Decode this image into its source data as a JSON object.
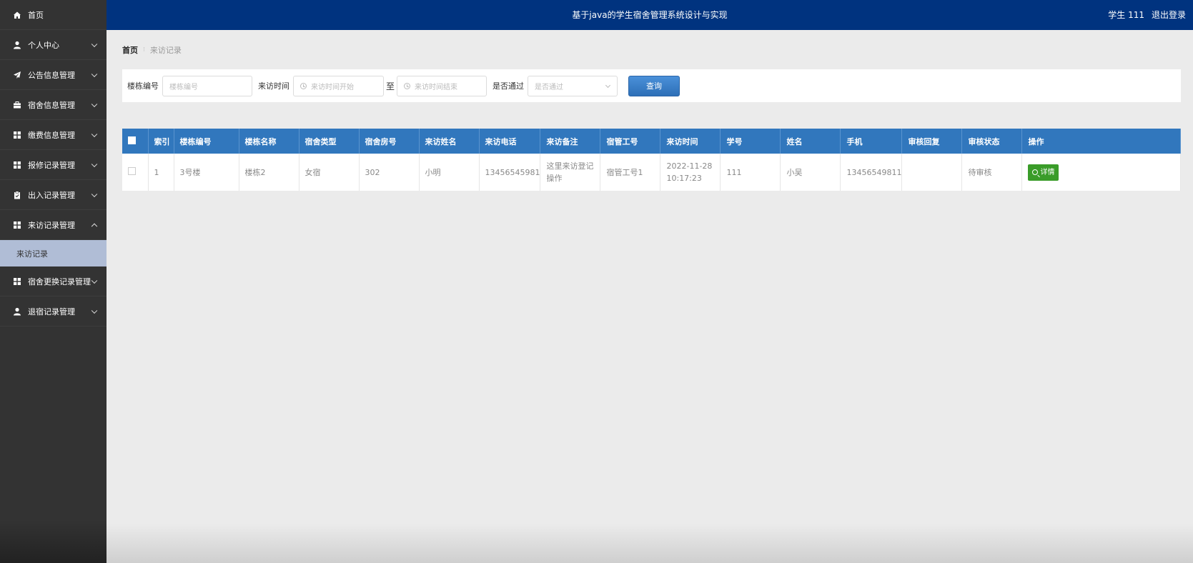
{
  "header": {
    "title": "基于java的学生宿舍管理系统设计与实现",
    "user_label": "学生 111",
    "logout_label": "退出登录",
    "bg_color": "#00337f"
  },
  "sidebar": {
    "items": [
      {
        "label": "首页",
        "icon": "home-icon"
      },
      {
        "label": "个人中心",
        "icon": "user-icon"
      },
      {
        "label": "公告信息管理",
        "icon": "send-icon"
      },
      {
        "label": "宿舍信息管理",
        "icon": "briefcase-icon"
      },
      {
        "label": "缴费信息管理",
        "icon": "grid-icon"
      },
      {
        "label": "报修记录管理",
        "icon": "grid-icon"
      },
      {
        "label": "出入记录管理",
        "icon": "clipboard-icon"
      },
      {
        "label": "来访记录管理",
        "icon": "grid-icon"
      },
      {
        "label": "宿舍更换记录管理",
        "icon": "grid-icon"
      },
      {
        "label": "退宿记录管理",
        "icon": "user-icon"
      }
    ],
    "active_sub": "来访记录"
  },
  "breadcrumb": {
    "home": "首页",
    "separator": "⁝",
    "current": "来访记录"
  },
  "search": {
    "building_label": "楼栋编号",
    "building_placeholder": "楼栋编号",
    "time_label": "来访时间",
    "time_start_placeholder": "来访时间开始",
    "to_label": "至",
    "time_end_placeholder": "来访时间结束",
    "passed_label": "是否通过",
    "passed_placeholder": "是否通过",
    "query_label": "查询"
  },
  "table": {
    "columns": [
      "索引",
      "楼栋编号",
      "楼栋名称",
      "宿舍类型",
      "宿舍房号",
      "来访姓名",
      "来访电话",
      "来访备注",
      "宿管工号",
      "来访时间",
      "学号",
      "姓名",
      "手机",
      "审核回复",
      "审核状态",
      "操作"
    ],
    "rows": [
      {
        "index": "1",
        "building_no": "3号楼",
        "building_name": "楼栋2",
        "dorm_type": "女宿",
        "room_no": "302",
        "visitor_name": "小明",
        "visitor_phone": "13456545981",
        "visitor_note": "这里来访登记操作",
        "staff_no": "宿管工号1",
        "visit_time": "2022-11-28 10:17:23",
        "student_no": "111",
        "name": "小吴",
        "mobile": "13456549811",
        "review_reply": "",
        "review_status": "待审核",
        "detail_label": "详情"
      }
    ]
  },
  "colors": {
    "table_header": "#3177bd",
    "detail_button": "#3a9c29",
    "active_sub_bg": "#b0bdd6"
  }
}
